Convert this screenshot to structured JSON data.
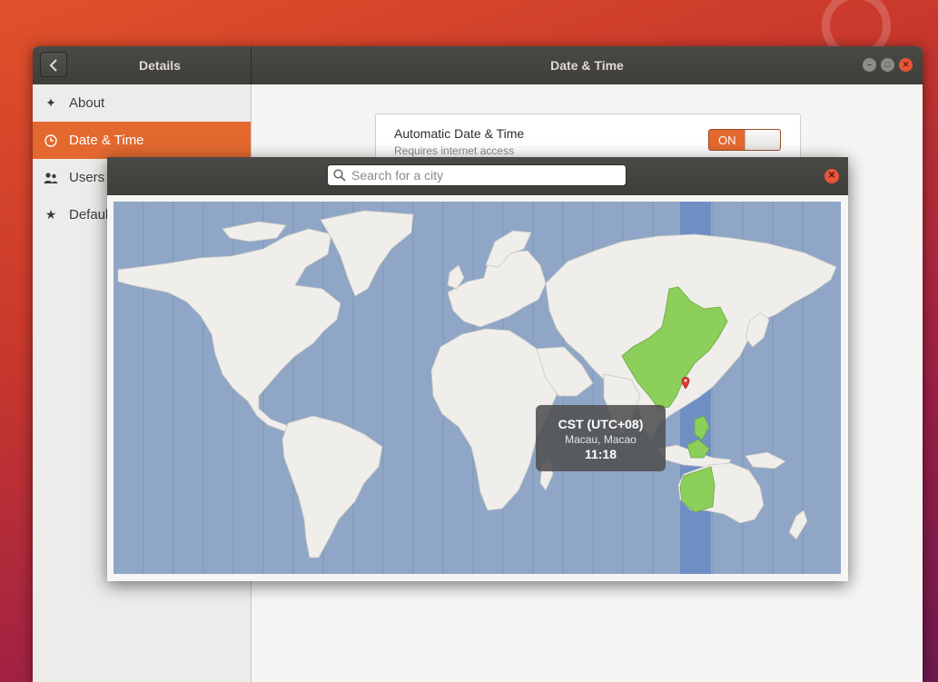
{
  "window": {
    "left_title": "Details",
    "title": "Date & Time"
  },
  "sidebar": {
    "items": [
      {
        "label": "About",
        "icon": "sparkle-icon",
        "active": false
      },
      {
        "label": "Date & Time",
        "icon": "clock-icon",
        "active": true
      },
      {
        "label": "Users",
        "icon": "users-icon",
        "active": false
      },
      {
        "label": "Defaul",
        "icon": "star-icon",
        "active": false
      }
    ]
  },
  "settings": {
    "automatic_title": "Automatic Date & Time",
    "automatic_subtitle": "Requires internet access",
    "toggle_label": "ON"
  },
  "dialog": {
    "search_placeholder": "Search for a city",
    "search_value": ""
  },
  "map": {
    "selected_zone": "UTC+08",
    "highlight_color": "#8ccf5a",
    "ocean_color": "#8fa6c6",
    "land_color": "#f0eeeb",
    "tooltip": {
      "timezone": "CST (UTC+08)",
      "city": "Macau, Macao",
      "time": "11:18"
    }
  },
  "colors": {
    "accent": "#e4692f",
    "headerbar": "#3f3e3a",
    "close_button": "#e9553a"
  }
}
